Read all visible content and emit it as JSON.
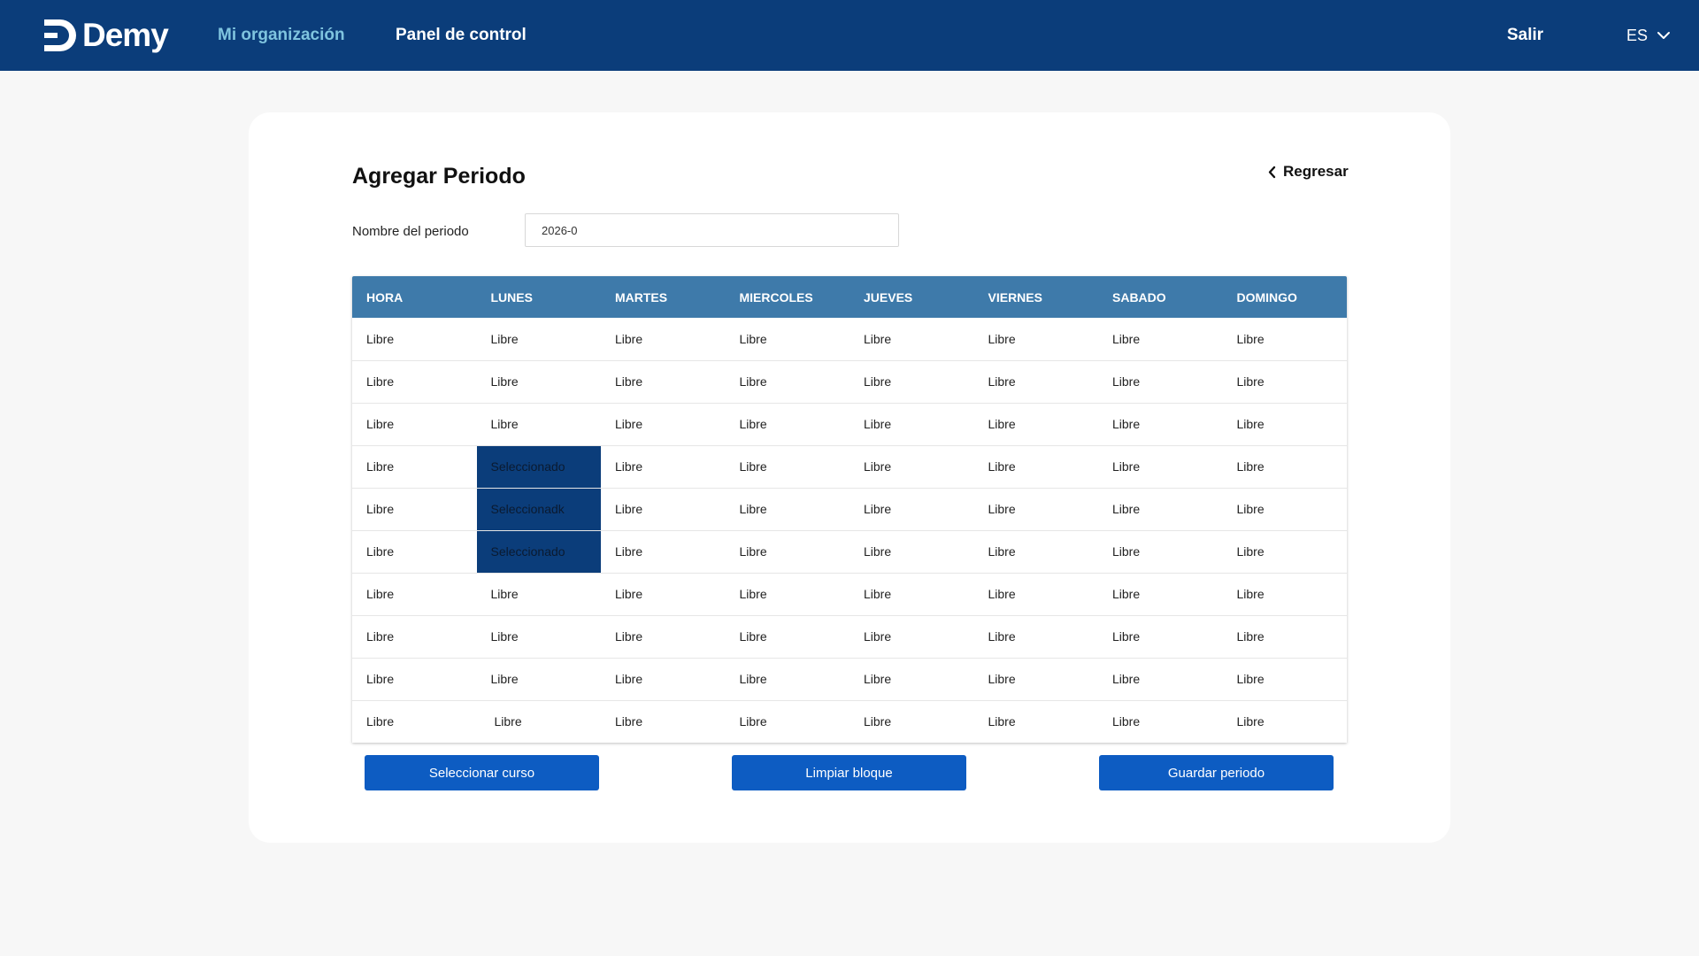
{
  "header": {
    "logo_text": "Demy",
    "nav": {
      "organization": "Mi organización",
      "panel": "Panel de control"
    },
    "logout": "Salir",
    "language": "ES"
  },
  "colors": {
    "nav_background": "#0b3d7a",
    "nav_active_link": "#7fc4df",
    "table_header": "#3e7aaa",
    "selected_cell": "#0b3d7a",
    "button": "#0d5cc2"
  },
  "page": {
    "title": "Agregar Periodo",
    "back_label": "Regresar"
  },
  "form": {
    "period_label": "Nombre del periodo",
    "period_value": "2026-0"
  },
  "schedule": {
    "headers": [
      "HORA",
      "LUNES",
      "MARTES",
      "MIERCOLES",
      "JUEVES",
      "VIERNES",
      "SABADO",
      "DOMINGO"
    ],
    "rows": [
      [
        "Libre",
        "Libre",
        "Libre",
        "Libre",
        "Libre",
        "Libre",
        "Libre",
        "Libre"
      ],
      [
        "Libre",
        "Libre",
        "Libre",
        "Libre",
        "Libre",
        "Libre",
        "Libre",
        "Libre"
      ],
      [
        "Libre",
        "Libre",
        "Libre",
        "Libre",
        "Libre",
        "Libre",
        "Libre",
        "Libre"
      ],
      [
        "Libre",
        "Seleccionado",
        "Libre",
        "Libre",
        "Libre",
        "Libre",
        "Libre",
        "Libre"
      ],
      [
        "Libre",
        "Seleccionadk",
        "Libre",
        "Libre",
        "Libre",
        "Libre",
        "Libre",
        "Libre"
      ],
      [
        "Libre",
        "Seleccionado",
        "Libre",
        "Libre",
        "Libre",
        "Libre",
        "Libre",
        "Libre"
      ],
      [
        "Libre",
        "Libre",
        "Libre",
        "Libre",
        "Libre",
        "Libre",
        "Libre",
        "Libre"
      ],
      [
        "Libre",
        "Libre",
        "Libre",
        "Libre",
        "Libre",
        "Libre",
        "Libre",
        "Libre"
      ],
      [
        "Libre",
        "Libre",
        "Libre",
        "Libre",
        "Libre",
        "Libre",
        "Libre",
        "Libre"
      ],
      [
        "Libre",
        "Libre",
        "Libre",
        "Libre",
        "Libre",
        "Libre",
        "Libre",
        "Libre"
      ]
    ],
    "selected_cells": [
      [
        3,
        1
      ],
      [
        4,
        1
      ],
      [
        5,
        1
      ]
    ]
  },
  "buttons": {
    "select_course": "Seleccionar curso",
    "clear_block": "Limpiar bloque",
    "save_period": "Guardar periodo"
  }
}
